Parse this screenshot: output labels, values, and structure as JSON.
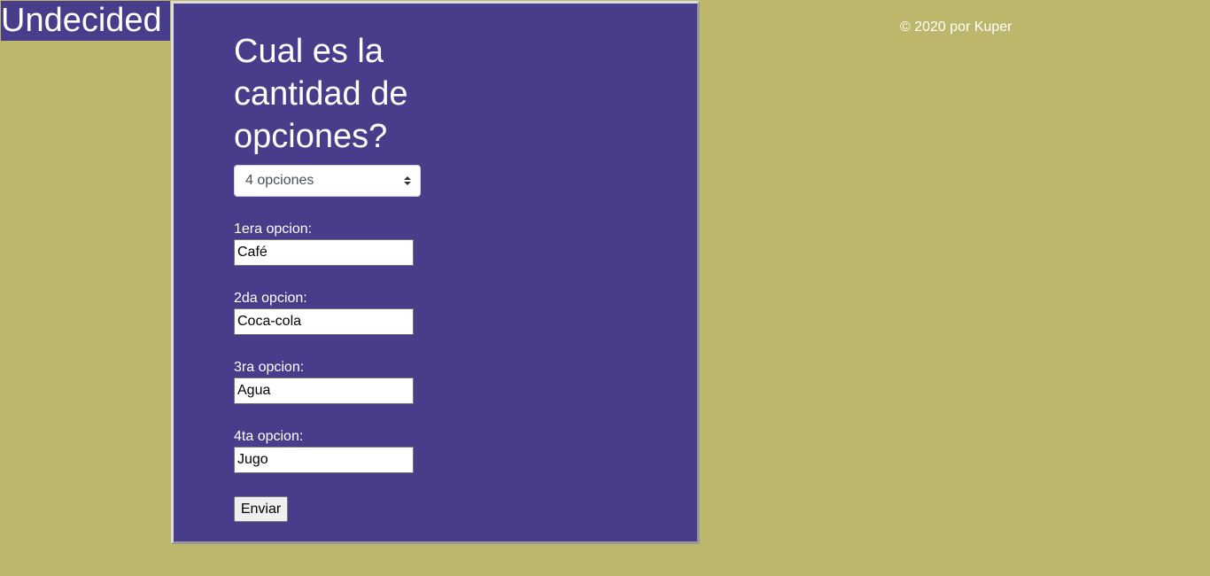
{
  "brand": {
    "title": "Undecided"
  },
  "form": {
    "question": "Cual es la cantidad de opciones?",
    "options_select": {
      "selected": "4 opciones",
      "icon": "select-arrows-icon"
    },
    "fields": [
      {
        "label": "1era opcion:",
        "value": "Café"
      },
      {
        "label": "2da opcion:",
        "value": "Coca-cola"
      },
      {
        "label": "3ra opcion:",
        "value": "Agua"
      },
      {
        "label": "4ta opcion:",
        "value": "Jugo"
      }
    ],
    "submit_label": "Enviar"
  },
  "footer": {
    "copyright": "© 2020 por Kuper"
  },
  "colors": {
    "page_background": "#bdb76b",
    "panel_background": "#483d8b",
    "text": "#ffffff"
  }
}
